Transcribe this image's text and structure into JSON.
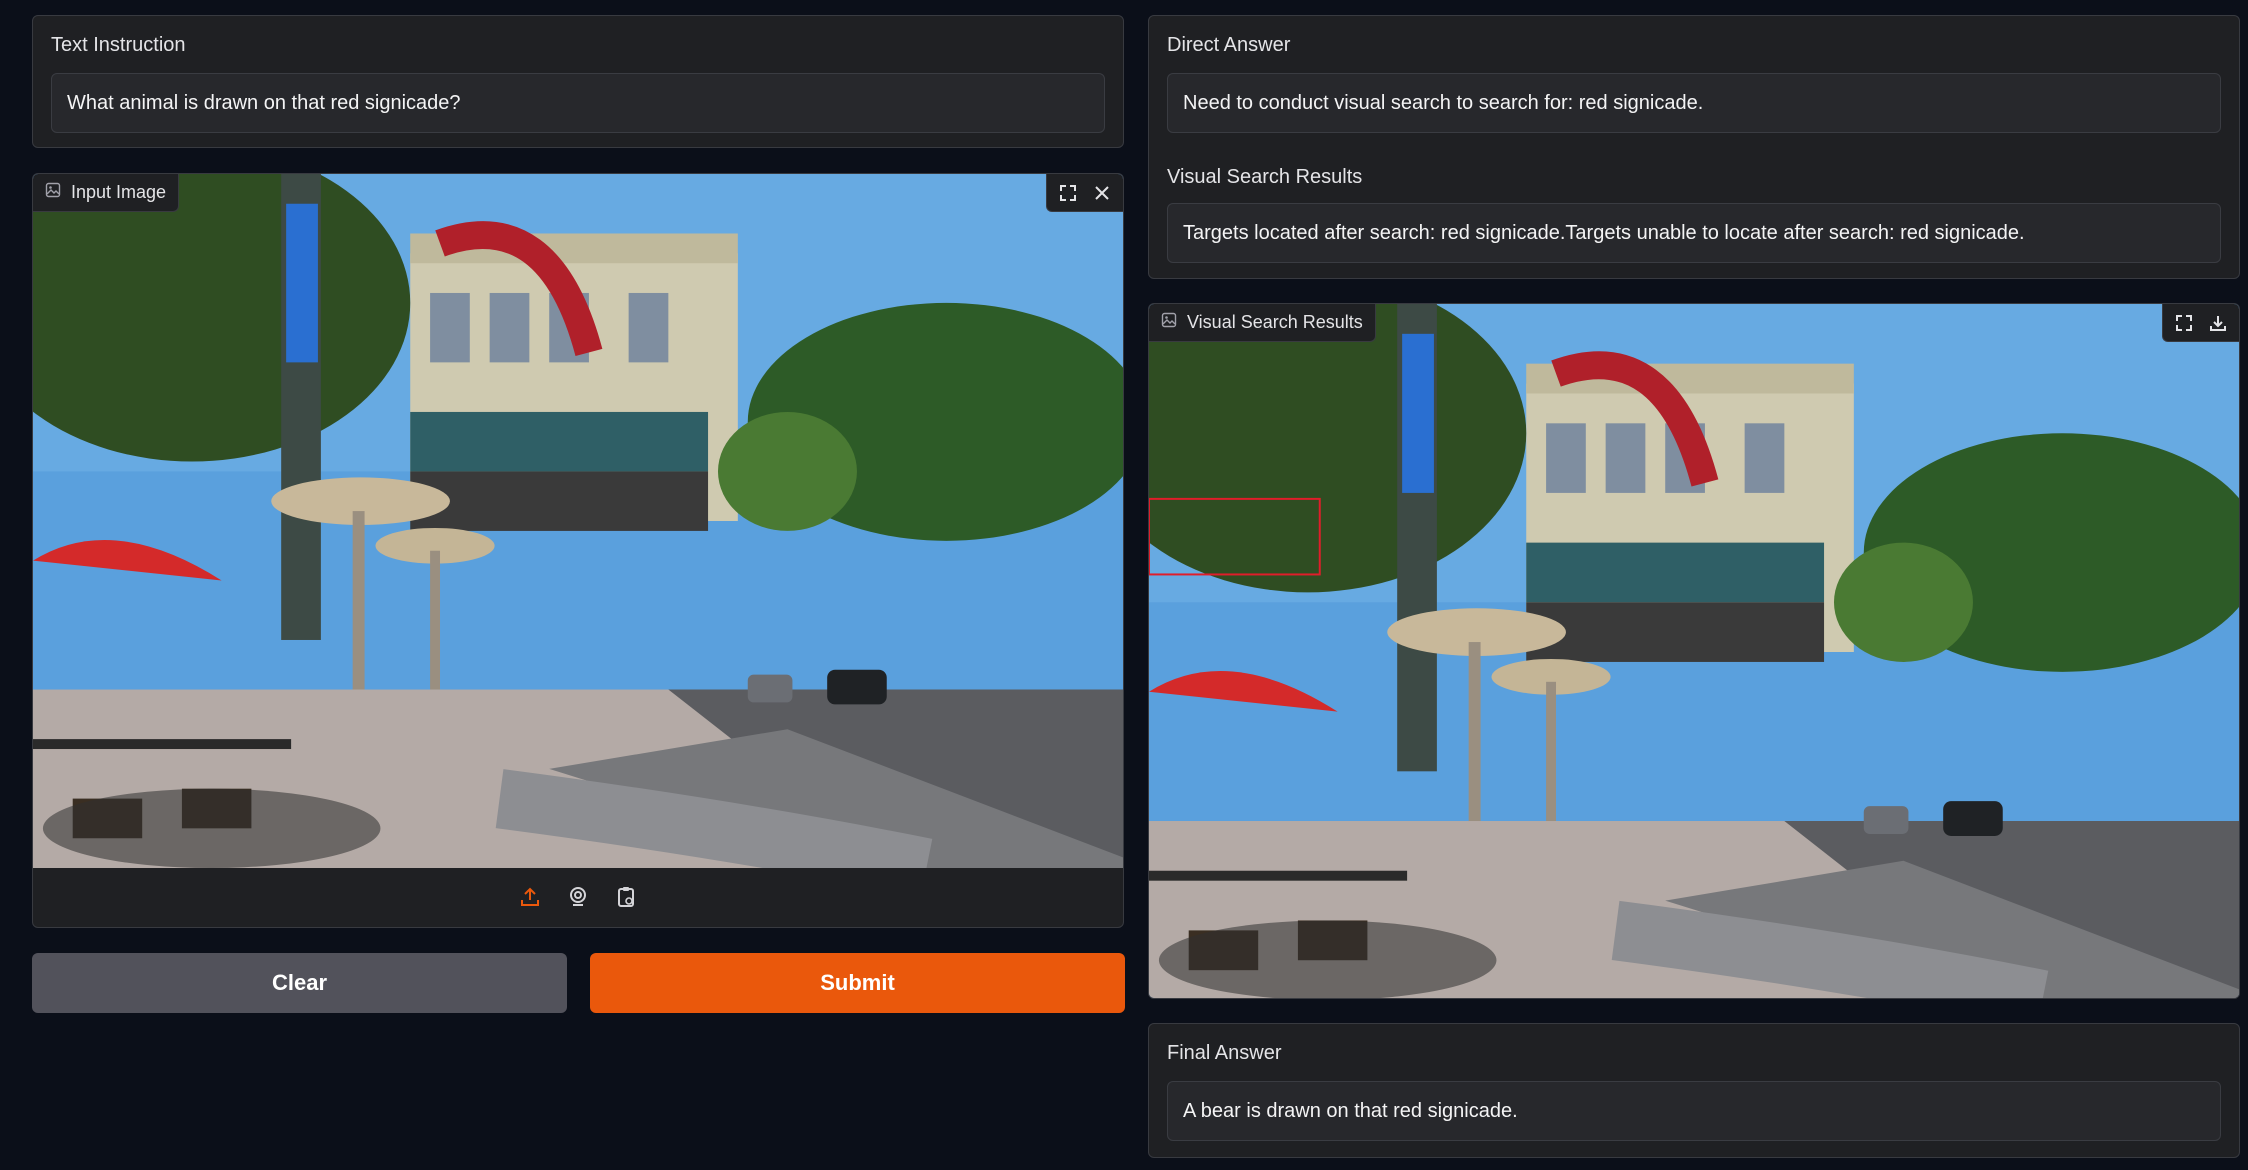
{
  "left": {
    "instruction_label": "Text Instruction",
    "instruction_value": "What animal is drawn on that red signicade?",
    "input_image_label": "Input Image",
    "clear_label": "Clear",
    "submit_label": "Submit"
  },
  "right": {
    "direct_answer_label": "Direct Answer",
    "direct_answer_value": "Need to conduct visual search to search for: red signicade.",
    "visual_search_label": "Visual Search Results",
    "visual_search_value": "Targets located after search: red signicade.Targets unable to locate after search: red signicade.",
    "visual_search_image_label": "Visual Search Results",
    "final_answer_label": "Final Answer",
    "final_answer_value": "A bear is drawn on that red signicade."
  },
  "icons": {
    "image": "image-icon",
    "fullscreen": "fullscreen-icon",
    "close": "close-icon",
    "download": "download-icon",
    "upload": "upload-icon",
    "webcam": "webcam-icon",
    "clipboard": "clipboard-icon"
  },
  "colors": {
    "accent": "#ea580c",
    "clear_button": "#52525b",
    "background": "#0b0f19",
    "panel": "#1f2023"
  }
}
